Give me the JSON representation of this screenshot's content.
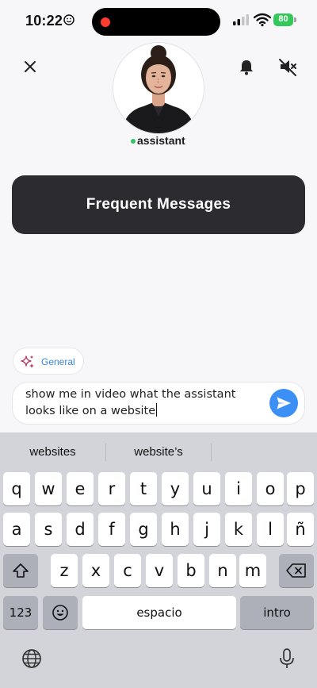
{
  "status_bar": {
    "time": "10:22",
    "battery": "80"
  },
  "header": {
    "assistant_name": "assistant"
  },
  "frequent_button": {
    "label": "Frequent Messages"
  },
  "chip": {
    "label": "General"
  },
  "composer": {
    "line1": "show me in video what the assistant",
    "line2": "looks like on a website"
  },
  "keyboard": {
    "suggestions": [
      "websites",
      "website’s",
      ""
    ],
    "row1": [
      "q",
      "w",
      "e",
      "r",
      "t",
      "y",
      "u",
      "i",
      "o",
      "p"
    ],
    "row2": [
      "a",
      "s",
      "d",
      "f",
      "g",
      "h",
      "j",
      "k",
      "l",
      "ñ"
    ],
    "row3": [
      "z",
      "x",
      "c",
      "v",
      "b",
      "n",
      "m"
    ],
    "numbers_label": "123",
    "space_label": "espacio",
    "return_label": "intro"
  },
  "colors": {
    "accent": "#3b8ff5",
    "dark_button": "#2c2b30",
    "online": "#31c56a",
    "battery": "#34c759"
  }
}
